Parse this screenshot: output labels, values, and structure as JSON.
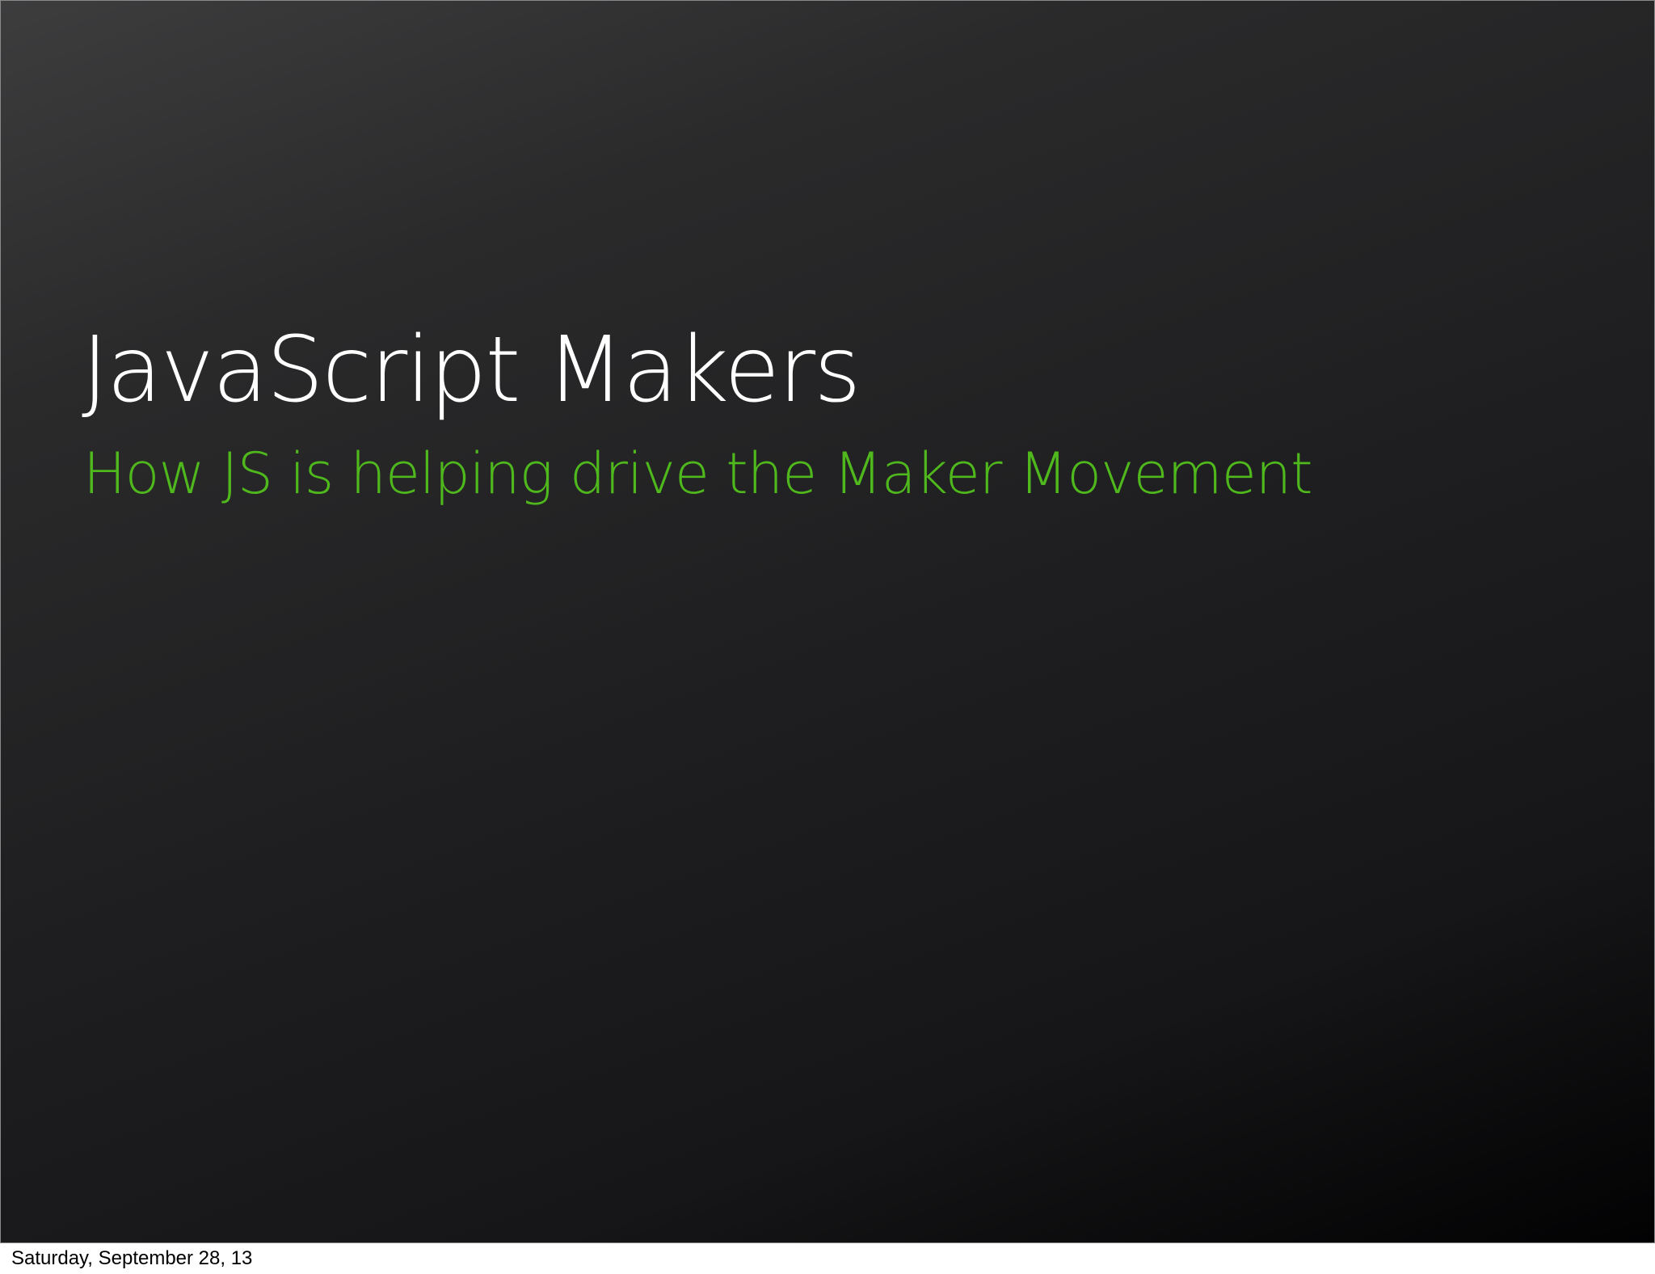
{
  "slide": {
    "title": "JavaScript Makers",
    "subtitle": "How JS is helping drive the Maker Movement",
    "title_color": "#ffffff",
    "subtitle_color": "#4fb81c"
  },
  "footer": {
    "date": "Saturday, September 28, 13"
  }
}
